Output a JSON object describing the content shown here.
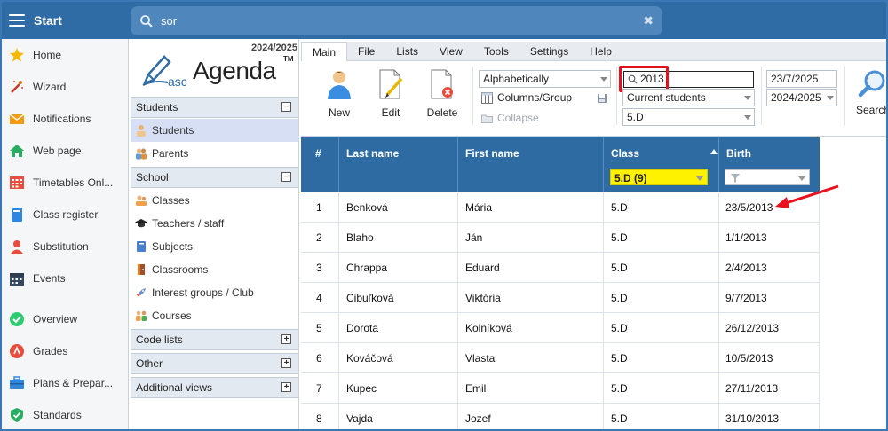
{
  "topbar": {
    "start_label": "Start",
    "search_value": "sor",
    "clear_glyph": "✖"
  },
  "leftnav": [
    {
      "label": "Home",
      "icon": "star-icon"
    },
    {
      "label": "Wizard",
      "icon": "magic-wand-icon"
    },
    {
      "label": "Notifications",
      "icon": "envelope-icon"
    },
    {
      "label": "Web page",
      "icon": "house-icon"
    },
    {
      "label": "Timetables Onl...",
      "icon": "timetable-icon"
    },
    {
      "label": "Class register",
      "icon": "register-icon"
    },
    {
      "label": "Substitution",
      "icon": "substitution-icon"
    },
    {
      "label": "Events",
      "icon": "calendar-icon"
    },
    {
      "label": "Overview",
      "icon": "check-circle-icon"
    },
    {
      "label": "Grades",
      "icon": "grades-icon"
    },
    {
      "label": "Plans & Prepar...",
      "icon": "briefcase-icon"
    },
    {
      "label": "Standards",
      "icon": "shield-check-icon"
    }
  ],
  "logo": {
    "year": "2024/2025",
    "asc": "asc",
    "agenda": "Agenda",
    "tm": "TM"
  },
  "sidebar": {
    "students_head": "Students",
    "students_items": [
      "Students",
      "Parents"
    ],
    "school_head": "School",
    "school_items": [
      "Classes",
      "Teachers / staff",
      "Subjects",
      "Classrooms",
      "Interest groups / Club",
      "Courses"
    ],
    "code_lists": "Code lists",
    "other": "Other",
    "additional": "Additional views",
    "minus": "−",
    "plus": "+"
  },
  "ribbon": {
    "tabs": [
      "Main",
      "File",
      "Lists",
      "View",
      "Tools",
      "Settings",
      "Help"
    ],
    "new": "New",
    "edit": "Edit",
    "delete": "Delete",
    "sort": "Alphabetically",
    "columns_group": "Columns/Group",
    "collapse": "Collapse",
    "filter_value": "2013",
    "student_scope": "Current students",
    "class_select": "5.D",
    "date": "23/7/2025",
    "school_year": "2024/2025",
    "search": "Search"
  },
  "grid": {
    "headers": {
      "num": "#",
      "last": "Last name",
      "first": "First name",
      "class": "Class",
      "birth": "Birth"
    },
    "class_filter": "5.D (9)",
    "rows": [
      {
        "n": "1",
        "last": "Benková",
        "first": "Mária",
        "class": "5.D",
        "birth": "23/5/2013"
      },
      {
        "n": "2",
        "last": "Blaho",
        "first": "Ján",
        "class": "5.D",
        "birth": "1/1/2013"
      },
      {
        "n": "3",
        "last": "Chrappa",
        "first": "Eduard",
        "class": "5.D",
        "birth": "2/4/2013"
      },
      {
        "n": "4",
        "last": "Cibuľková",
        "first": "Viktória",
        "class": "5.D",
        "birth": "9/7/2013"
      },
      {
        "n": "5",
        "last": "Dorota",
        "first": "Kolníková",
        "class": "5.D",
        "birth": "26/12/2013"
      },
      {
        "n": "6",
        "last": "Kováčová",
        "first": "Vlasta",
        "class": "5.D",
        "birth": "10/5/2013"
      },
      {
        "n": "7",
        "last": "Kupec",
        "first": "Emil",
        "class": "5.D",
        "birth": "27/11/2013"
      },
      {
        "n": "8",
        "last": "Vajda",
        "first": "Jozef",
        "class": "5.D",
        "birth": "31/10/2013"
      }
    ]
  },
  "colors": {
    "topbar": "#2f6ca5",
    "grid_header": "#2e6ba3",
    "highlight": "#e8121e",
    "class_filter": "#fff200"
  }
}
